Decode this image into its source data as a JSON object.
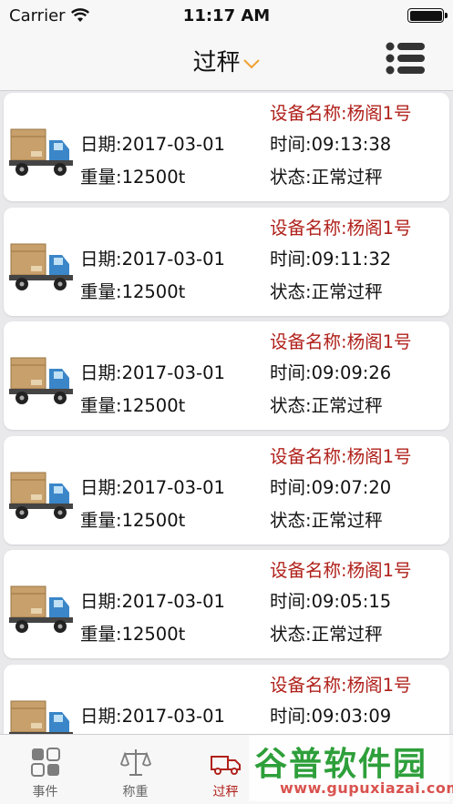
{
  "status_bar": {
    "carrier": "Carrier",
    "time": "11:17 AM"
  },
  "nav": {
    "title": "过秤",
    "title_icon": "chevron-down-icon",
    "menu_icon": "list-menu-icon"
  },
  "records": [
    {
      "device": "设备名称:杨阁1号",
      "date": "日期:2017-03-01",
      "time": "时间:09:13:38",
      "weight": "重量:12500t",
      "state": "状态:正常过秤"
    },
    {
      "device": "设备名称:杨阁1号",
      "date": "日期:2017-03-01",
      "time": "时间:09:11:32",
      "weight": "重量:12500t",
      "state": "状态:正常过秤"
    },
    {
      "device": "设备名称:杨阁1号",
      "date": "日期:2017-03-01",
      "time": "时间:09:09:26",
      "weight": "重量:12500t",
      "state": "状态:正常过秤"
    },
    {
      "device": "设备名称:杨阁1号",
      "date": "日期:2017-03-01",
      "time": "时间:09:07:20",
      "weight": "重量:12500t",
      "state": "状态:正常过秤"
    },
    {
      "device": "设备名称:杨阁1号",
      "date": "日期:2017-03-01",
      "time": "时间:09:05:15",
      "weight": "重量:12500t",
      "state": "状态:正常过秤"
    },
    {
      "device": "设备名称:杨阁1号",
      "date": "日期:2017-03-01",
      "time": "时间:09:03:09",
      "weight": "",
      "state": ""
    }
  ],
  "tabs": [
    {
      "label": "事件",
      "icon": "grid-icon",
      "active": false
    },
    {
      "label": "称重",
      "icon": "scale-icon",
      "active": false
    },
    {
      "label": "过秤",
      "icon": "truck-icon",
      "active": true
    }
  ],
  "watermark": {
    "main": "谷普软件园",
    "url": "www.gupuxiazai.com"
  },
  "colors": {
    "accent": "#b0211b",
    "chevron": "#f0a030",
    "truck_cab": "#3a86c8",
    "box": "#c8a06c"
  }
}
